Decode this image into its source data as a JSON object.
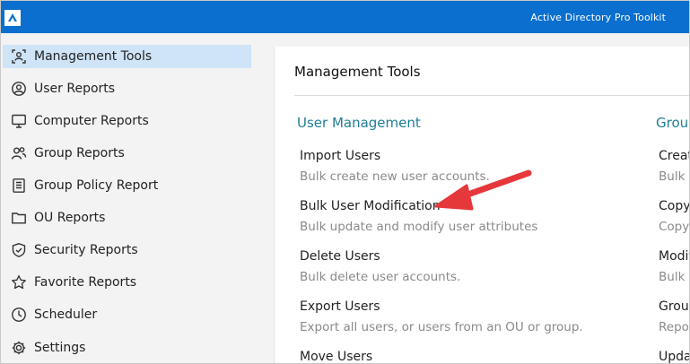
{
  "titlebar": {
    "app_title": "Active Directory Pro Toolkit"
  },
  "sidebar": {
    "items": [
      {
        "label": "Management Tools",
        "icon": "management-tools-icon",
        "active": true
      },
      {
        "label": "User Reports",
        "icon": "user-icon"
      },
      {
        "label": "Computer Reports",
        "icon": "monitor-icon"
      },
      {
        "label": "Group Reports",
        "icon": "group-icon"
      },
      {
        "label": "Group Policy Report",
        "icon": "policy-icon"
      },
      {
        "label": "OU Reports",
        "icon": "folder-icon"
      },
      {
        "label": "Security Reports",
        "icon": "shield-icon"
      },
      {
        "label": "Favorite Reports",
        "icon": "star-icon"
      },
      {
        "label": "Scheduler",
        "icon": "clock-icon"
      },
      {
        "label": "Settings",
        "icon": "gear-icon"
      }
    ]
  },
  "main": {
    "title": "Management Tools",
    "sections": [
      {
        "heading": "User Management",
        "tools": [
          {
            "name": "Import Users",
            "desc": "Bulk create new user accounts."
          },
          {
            "name": "Bulk User Modification",
            "desc": "Bulk update and modify user attributes"
          },
          {
            "name": "Delete Users",
            "desc": "Bulk delete user accounts."
          },
          {
            "name": "Export Users",
            "desc": "Export all users, or users from an OU or group."
          },
          {
            "name": "Move Users",
            "desc": ""
          }
        ]
      },
      {
        "heading": "Group",
        "tools": [
          {
            "name": "Creat",
            "desc": "Bulk c"
          },
          {
            "name": "Copy",
            "desc": "Copy"
          },
          {
            "name": "Modif",
            "desc": "Bulk"
          },
          {
            "name": "Group",
            "desc": "Repo"
          },
          {
            "name": "Upda",
            "desc": ""
          }
        ]
      }
    ]
  },
  "colors": {
    "titlebar": "#0a6fcf",
    "active_nav": "#cfe4f7",
    "section_heading": "#1f7e95",
    "annotation_arrow": "#e5383b"
  }
}
